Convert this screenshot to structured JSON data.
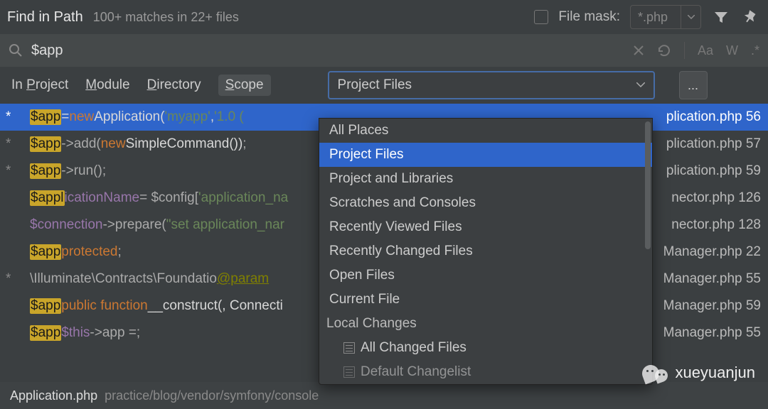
{
  "title": "Find in Path",
  "subtitle": "100+ matches in 22+ files",
  "file_mask": {
    "label": "File mask:",
    "value": "*.php"
  },
  "search": {
    "value": "$app"
  },
  "toolbar": {
    "case": "Aa",
    "word": "W",
    "regex": ".*"
  },
  "tabs": {
    "project": "In Project",
    "module": "Module",
    "directory": "Directory",
    "scope": "Scope",
    "project_u": "P",
    "module_u": "M",
    "directory_u": "D",
    "scope_u": "S"
  },
  "scope_select": {
    "value": "Project Files"
  },
  "more": "...",
  "dropdown": {
    "items": [
      "All Places",
      "Project Files",
      "Project and Libraries",
      "Scratches and Consoles",
      "Recently Viewed Files",
      "Recently Changed Files",
      "Open Files",
      "Current File"
    ],
    "group": "Local Changes",
    "sub": [
      "All Changed Files",
      "Default Changelist"
    ],
    "selected_index": 1
  },
  "results": [
    {
      "star": "*",
      "pre": "",
      "hl": "$app",
      "post_plain": " = ",
      "kw": "new ",
      "wht": "Application(",
      "str": "'myapp'",
      "wht2": ", ",
      "str2": "'1.0 (",
      "file": "plication.php 56",
      "sel": true
    },
    {
      "star": "*",
      "pre": "",
      "hl": "$app",
      "post": "->add(",
      "kw": "new ",
      "wht": "SimpleCommand())",
      "gry": ";",
      "file": "plication.php 57"
    },
    {
      "star": "*",
      "pre": "",
      "hl": "$app",
      "post": "->run()",
      "gry": ";",
      "file": "plication.php 59"
    },
    {
      "hl": "$appl",
      "prop": "icationName",
      "post": " = $config[",
      "str": "'application_na",
      "file": "nector.php 126"
    },
    {
      "prop": "$connection",
      "post": "->prepare(",
      "str": "\"set application_nar",
      "file": "nector.php 128"
    },
    {
      "kw": "protected ",
      "hl": "$app",
      "gry": ";",
      "file": "Manager.php 22"
    },
    {
      "star": "*",
      "tag": "@param",
      "post": "  \\Illuminate\\Contracts\\Foundatio",
      "file": "Manager.php 55"
    },
    {
      "kw": "public function ",
      "wht": "__construct(",
      "hl": "$app",
      "wht2": ", Connecti",
      "file": "Manager.php 59"
    },
    {
      "prop": "$this",
      "gry": "->app = ",
      "hl": "$app",
      "gry2": ";",
      "file": "Manager.php 55"
    }
  ],
  "footer": {
    "file": "Application.php",
    "path": "practice/blog/vendor/symfony/console"
  },
  "watermark": "xueyuanjun"
}
